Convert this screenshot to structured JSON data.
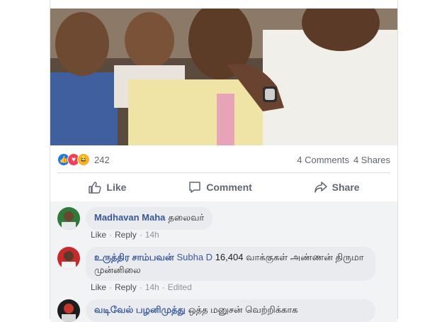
{
  "post": {
    "reaction_count": "242",
    "comments_count": "4 Comments",
    "shares_count": "4 Shares",
    "reaction_icons": [
      "like-icon",
      "love-icon",
      "haha-icon"
    ]
  },
  "actions": {
    "like": "Like",
    "comment": "Comment",
    "share": "Share"
  },
  "comments": [
    {
      "author": "Madhavan Maha",
      "mention": "",
      "text": "தலைவர்",
      "like": "Like",
      "reply": "Reply",
      "time": "14h",
      "edited": ""
    },
    {
      "author": "உருத்திர சாம்பவன்",
      "mention": "Subha D",
      "text": "16,404 வாக்குகள் அண்ணன் திருமா முன்னிலை",
      "like": "Like",
      "reply": "Reply",
      "time": "14h",
      "edited": "Edited"
    },
    {
      "author": "வடிவேல் பழனிமுத்து",
      "mention": "",
      "text": "ஒத்த மனுசன் வெற்றிக்காக",
      "like": "",
      "reply": "",
      "time": "",
      "edited": ""
    }
  ],
  "colors": {
    "link": "#385898",
    "like_blue": "#1877f2",
    "love_red": "#f33e58",
    "haha_yellow": "#f7b125"
  }
}
